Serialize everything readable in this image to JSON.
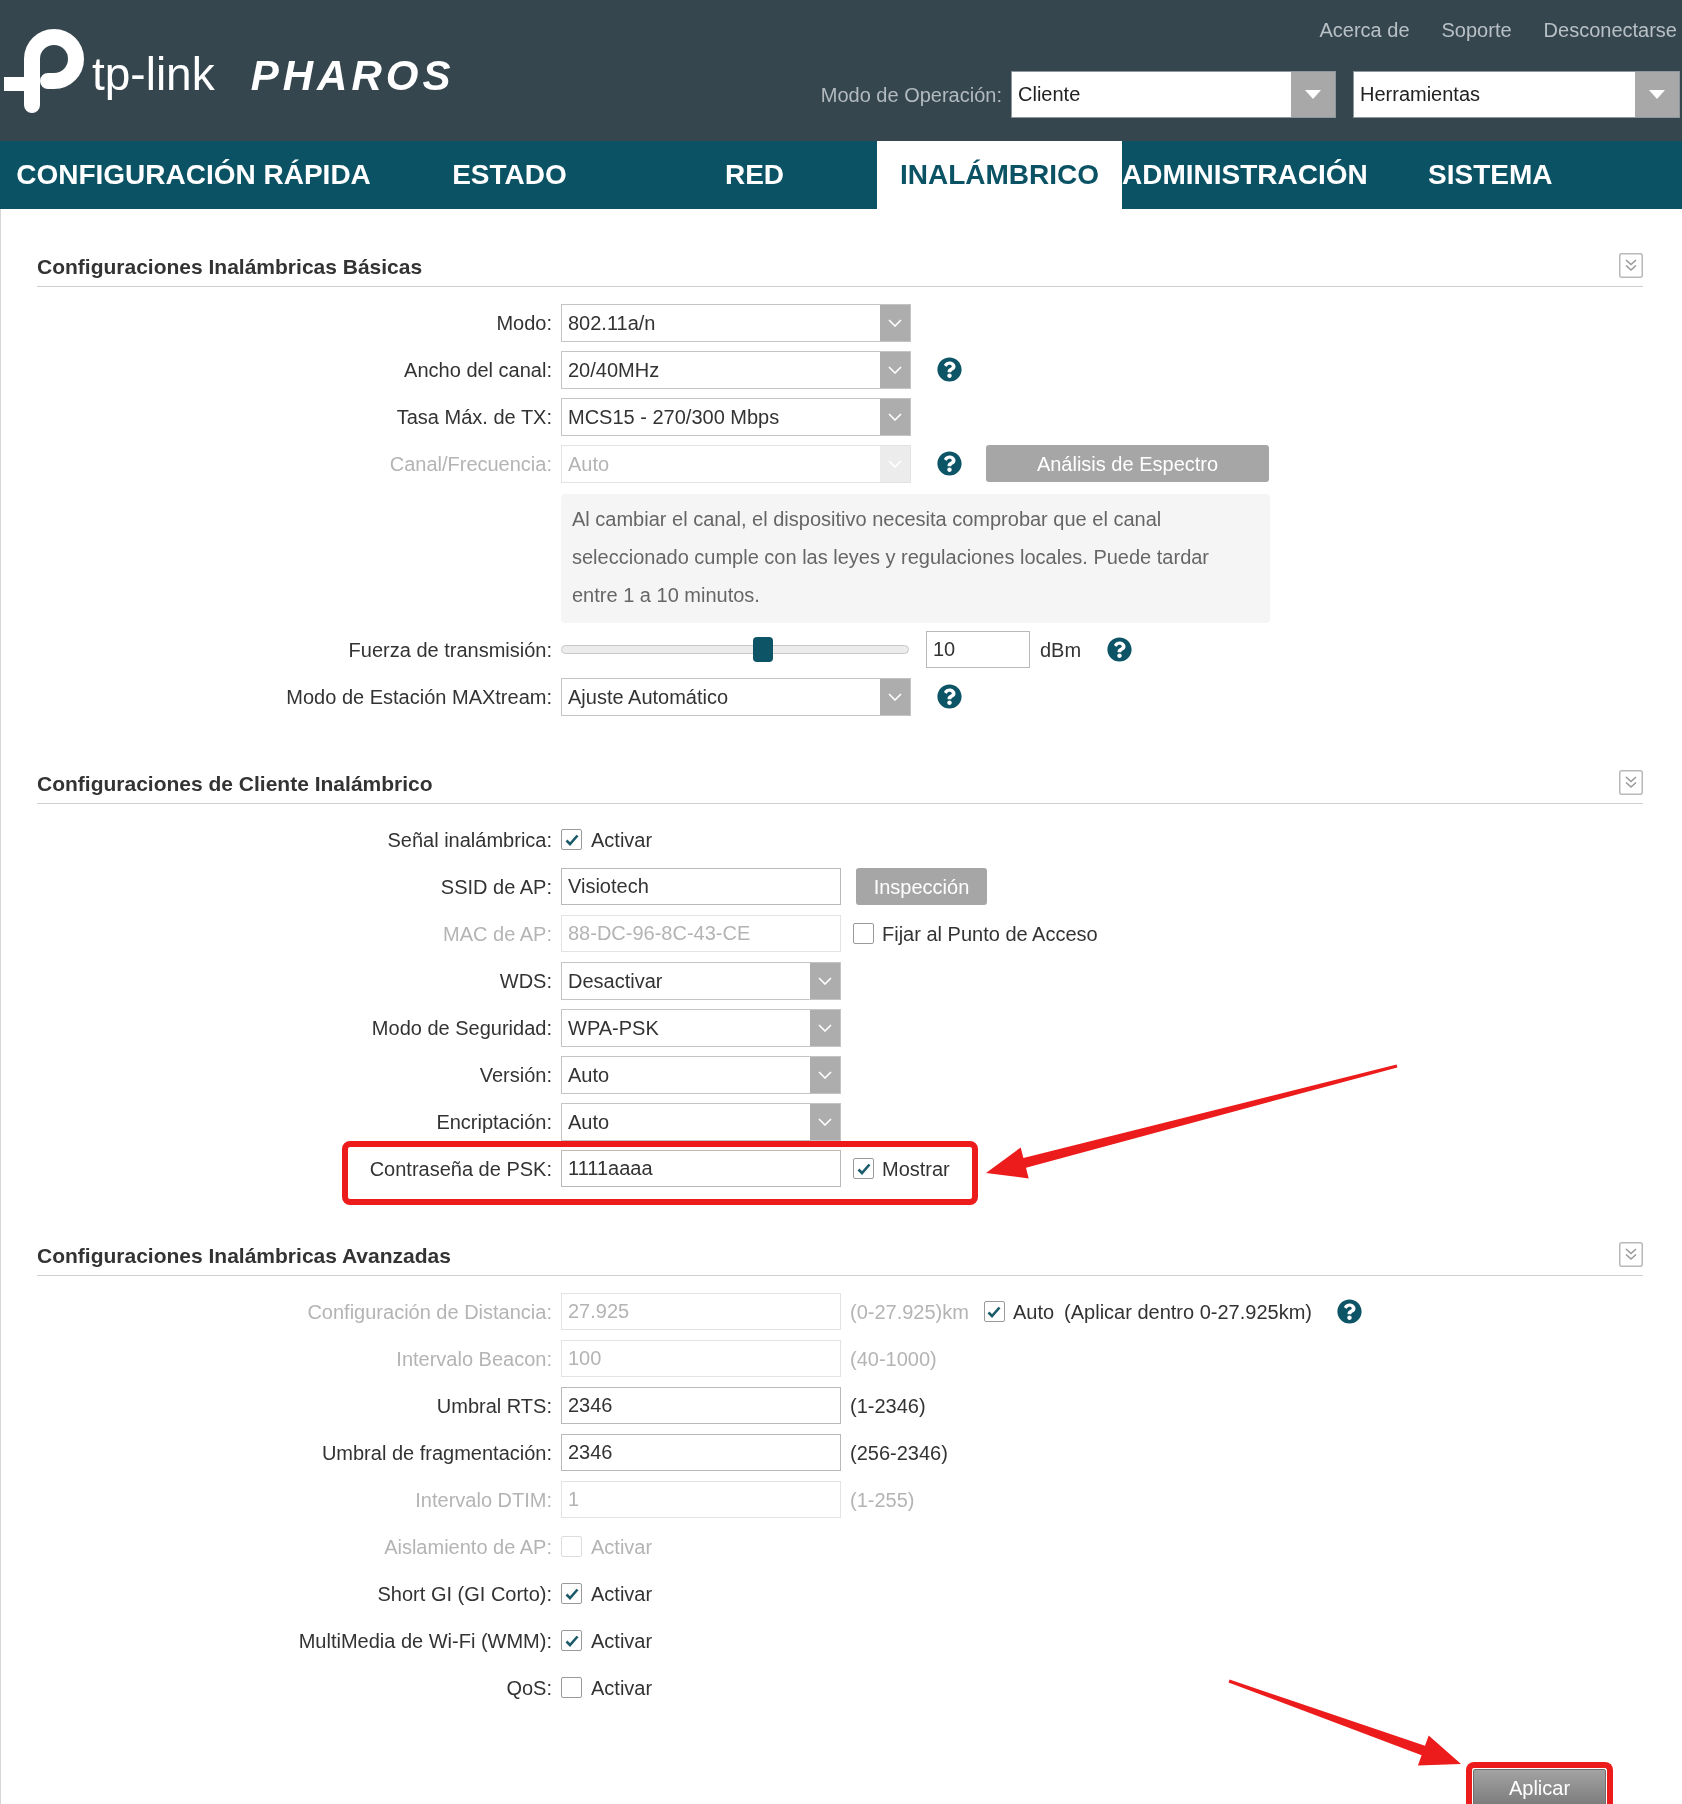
{
  "header": {
    "logo": {
      "brand": "tp-link",
      "product": "PHAROS"
    },
    "links": [
      "Acerca de",
      "Soporte",
      "Desconectarse"
    ],
    "operation_mode": {
      "label": "Modo de Operación:",
      "value": "Cliente"
    },
    "tools": {
      "value": "Herramientas"
    }
  },
  "tabs": [
    {
      "label": "CONFIGURACIÓN RÁPIDA",
      "selected": false
    },
    {
      "label": "ESTADO",
      "selected": false
    },
    {
      "label": "RED",
      "selected": false
    },
    {
      "label": "INALÁMBRICO",
      "selected": true
    },
    {
      "label": "ADMINISTRACIÓN",
      "selected": false
    },
    {
      "label": "SISTEMA",
      "selected": false
    }
  ],
  "sections": [
    {
      "title": "Configuraciones Inalámbricas Básicas",
      "rows": [
        {
          "kind": "select",
          "label": "Modo:",
          "value": "802.11a/n",
          "disabled": false,
          "help": false
        },
        {
          "kind": "select",
          "label": "Ancho del canal:",
          "value": "20/40MHz",
          "disabled": false,
          "help": true
        },
        {
          "kind": "select",
          "label": "Tasa Máx. de TX:",
          "value": "MCS15 - 270/300 Mbps",
          "disabled": false,
          "help": false
        },
        {
          "kind": "select",
          "label": "Canal/Frecuencia:",
          "value": "Auto",
          "disabled": true,
          "help": true,
          "button": {
            "label": "Análisis de Espectro"
          }
        },
        {
          "kind": "note",
          "text": "Al cambiar el canal, el dispositivo necesita comprobar que el canal seleccionado cumple con las leyes y regulaciones locales. Puede tardar entre 1 a 10 minutos."
        },
        {
          "kind": "slider",
          "label": "Fuerza de transmisión:",
          "level": 0.58,
          "value": "10",
          "unit": "dBm",
          "help": true
        },
        {
          "kind": "select",
          "label": "Modo de Estación MAXtream:",
          "value": "Ajuste Automático",
          "disabled": false,
          "help": true
        }
      ]
    },
    {
      "title": "Configuraciones de Cliente Inalámbrico",
      "rows": [
        {
          "kind": "checkbox",
          "label": "Señal inalámbrica:",
          "checked": true,
          "disabled": false,
          "option": "Activar",
          "highlighted": false
        },
        {
          "kind": "input",
          "label": "SSID de AP:",
          "value": "Visiotech",
          "disabled": false,
          "button": {
            "label": "Inspección"
          },
          "highlighted": false
        },
        {
          "kind": "input",
          "label": "MAC de AP:",
          "value": "88-DC-96-8C-43-CE",
          "disabled": true,
          "checkbox": {
            "label": "Fijar al Punto de Acceso",
            "checked": false
          },
          "highlighted": false
        },
        {
          "kind": "select",
          "label": "WDS:",
          "value": "Desactivar",
          "disabled": false,
          "highlighted": false
        },
        {
          "kind": "select",
          "label": "Modo de Seguridad:",
          "value": "WPA-PSK",
          "disabled": false,
          "highlighted": false
        },
        {
          "kind": "select",
          "label": "Versión:",
          "value": "Auto",
          "disabled": false,
          "highlighted": false
        },
        {
          "kind": "select",
          "label": "Encriptación:",
          "value": "Auto",
          "disabled": false,
          "highlighted": false
        },
        {
          "kind": "input",
          "label": "Contraseña de PSK:",
          "value": "1111aaaa",
          "disabled": false,
          "checkbox": {
            "label": "Mostrar",
            "checked": true
          },
          "highlighted": true
        }
      ]
    },
    {
      "title": "Configuraciones Inalámbricas Avanzadas",
      "rows": [
        {
          "kind": "input",
          "label": "Configuración de Distancia:",
          "value": "27.925",
          "disabled": true,
          "range": "(0-27.925)km",
          "checkbox": {
            "label": "Auto",
            "checked": true
          },
          "hint": "(Aplicar dentro 0-27.925km)",
          "help": true
        },
        {
          "kind": "input",
          "label": "Intervalo Beacon:",
          "value": "100",
          "disabled": true,
          "range": "(40-1000)",
          "help": false
        },
        {
          "kind": "input",
          "label": "Umbral RTS:",
          "value": "2346",
          "disabled": false,
          "range": "(1-2346)",
          "help": false
        },
        {
          "kind": "input",
          "label": "Umbral de fragmentación:",
          "value": "2346",
          "disabled": false,
          "range": "(256-2346)",
          "help": false
        },
        {
          "kind": "input",
          "label": "Intervalo DTIM:",
          "value": "1",
          "disabled": true,
          "range": "(1-255)",
          "help": false
        },
        {
          "kind": "checkbox",
          "label": "Aislamiento de AP:",
          "checked": false,
          "disabled": true,
          "option": "Activar",
          "help": false
        },
        {
          "kind": "checkbox",
          "label": "Short GI (GI Corto):",
          "checked": true,
          "disabled": false,
          "option": "Activar",
          "help": false
        },
        {
          "kind": "checkbox",
          "label": "MultiMedia de Wi-Fi (WMM):",
          "checked": true,
          "disabled": false,
          "option": "Activar",
          "help": false
        },
        {
          "kind": "checkbox",
          "label": "QoS:",
          "checked": false,
          "disabled": false,
          "option": "Activar",
          "help": false
        }
      ]
    }
  ],
  "apply": {
    "label": "Aplicar",
    "highlighted": true
  }
}
